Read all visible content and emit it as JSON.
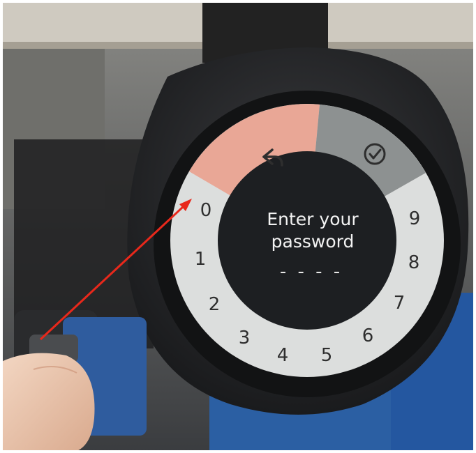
{
  "screen": {
    "prompt_line1": "Enter your",
    "prompt_line2": "password",
    "password_mask": "- - - -"
  },
  "dial": {
    "back_icon": "back-arrow-icon",
    "confirm_icon": "check-circle-icon",
    "digits": [
      "0",
      "1",
      "2",
      "3",
      "4",
      "5",
      "6",
      "7",
      "8",
      "9"
    ]
  },
  "colors": {
    "back_segment": "#e9a796",
    "confirm_segment": "#8d9191",
    "dial_ring": "#dcdedd",
    "screen": "#1d1f22",
    "bezel": "#2a2b2d",
    "arrow": "#e8281b"
  }
}
